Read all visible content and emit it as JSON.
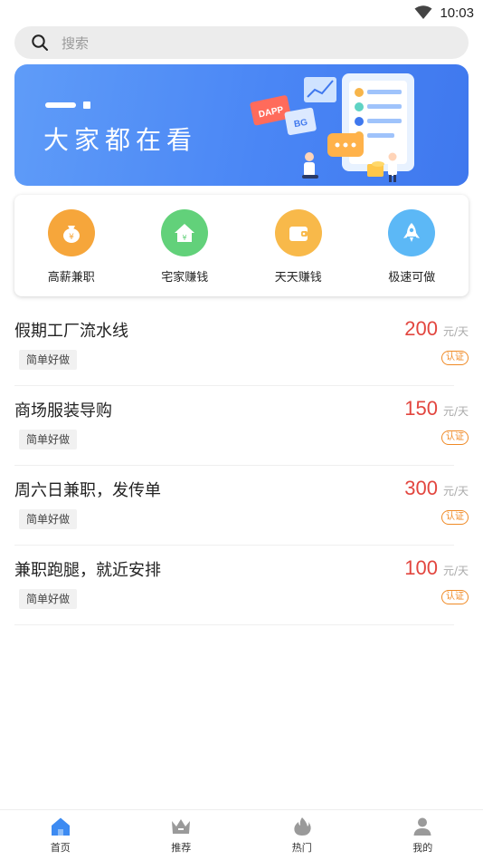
{
  "status_bar": {
    "time": "10:03",
    "wifi_icon": "wifi-icon"
  },
  "search": {
    "placeholder": "搜索",
    "icon": "search-icon"
  },
  "banner": {
    "title": "大家都在看",
    "art_labels": [
      "DAPP",
      "BG"
    ]
  },
  "categories": [
    {
      "label": "高薪兼职",
      "icon": "money-bag-icon",
      "color": "#f6a63b"
    },
    {
      "label": "宅家赚钱",
      "icon": "house-icon",
      "color": "#62d17a"
    },
    {
      "label": "天天赚钱",
      "icon": "wallet-icon",
      "color": "#f8b94a"
    },
    {
      "label": "极速可做",
      "icon": "rocket-icon",
      "color": "#5cb8f6"
    }
  ],
  "jobs": [
    {
      "title": "假期工厂流水线",
      "tag": "简单好做",
      "price": "200",
      "unit": "元/天",
      "badge": "认证"
    },
    {
      "title": "商场服装导购",
      "tag": "简单好做",
      "price": "150",
      "unit": "元/天",
      "badge": "认证"
    },
    {
      "title": "周六日兼职，发传单",
      "tag": "简单好做",
      "price": "300",
      "unit": "元/天",
      "badge": "认证"
    },
    {
      "title": "兼职跑腿，就近安排",
      "tag": "简单好做",
      "price": "100",
      "unit": "元/天",
      "badge": "认证"
    }
  ],
  "tabbar": {
    "items": [
      {
        "label": "首页",
        "icon": "home-icon",
        "active": true
      },
      {
        "label": "推荐",
        "icon": "crown-icon",
        "active": false
      },
      {
        "label": "热门",
        "icon": "fire-icon",
        "active": false
      },
      {
        "label": "我的",
        "icon": "user-icon",
        "active": false
      }
    ]
  },
  "colors": {
    "accent": "#4a86f5",
    "price": "#e2463f",
    "badge": "#f08a25",
    "search_bg": "#ececec"
  }
}
